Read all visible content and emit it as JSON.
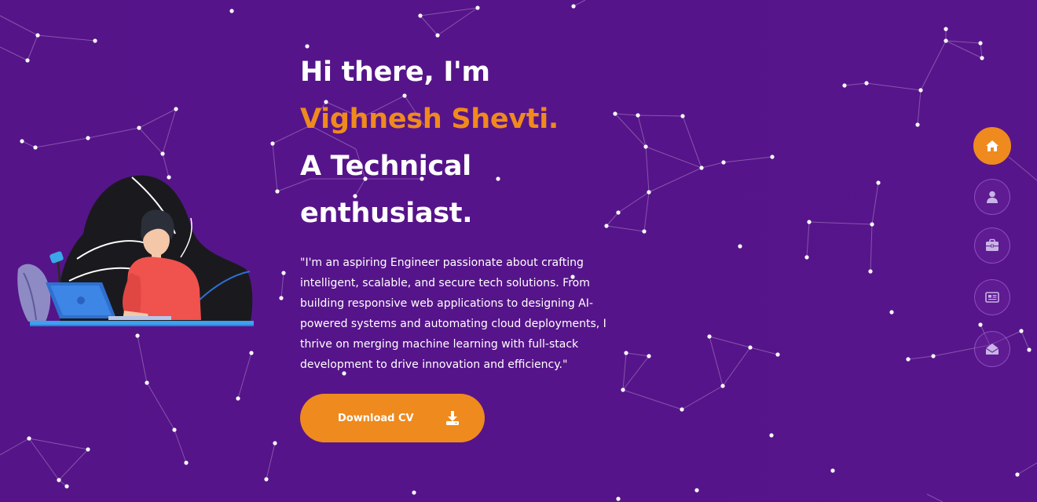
{
  "hero": {
    "greeting": "Hi there, I'm",
    "name": "Vighnesh Shevti.",
    "role_line_1": "A Technical",
    "role_line_2": "enthusiast.",
    "intro": "\"I'm an aspiring Engineer passionate about crafting intelligent, scalable, and secure tech solutions. From building responsive web applications to designing AI-powered systems and automating cloud deployments, I thrive on merging machine learning with full-stack development to drive innovation and efficiency.\""
  },
  "cta": {
    "download_cv_label": "Download CV",
    "icon": "download-icon"
  },
  "side_nav": {
    "items": [
      {
        "icon": "home-icon",
        "active": true
      },
      {
        "icon": "user-icon",
        "active": false
      },
      {
        "icon": "briefcase-icon",
        "active": false
      },
      {
        "icon": "newspaper-icon",
        "active": false
      },
      {
        "icon": "envelope-open-icon",
        "active": false
      }
    ]
  },
  "colors": {
    "background": "#56148a",
    "accent": "#ef8a1e",
    "text": "#ffffff"
  }
}
